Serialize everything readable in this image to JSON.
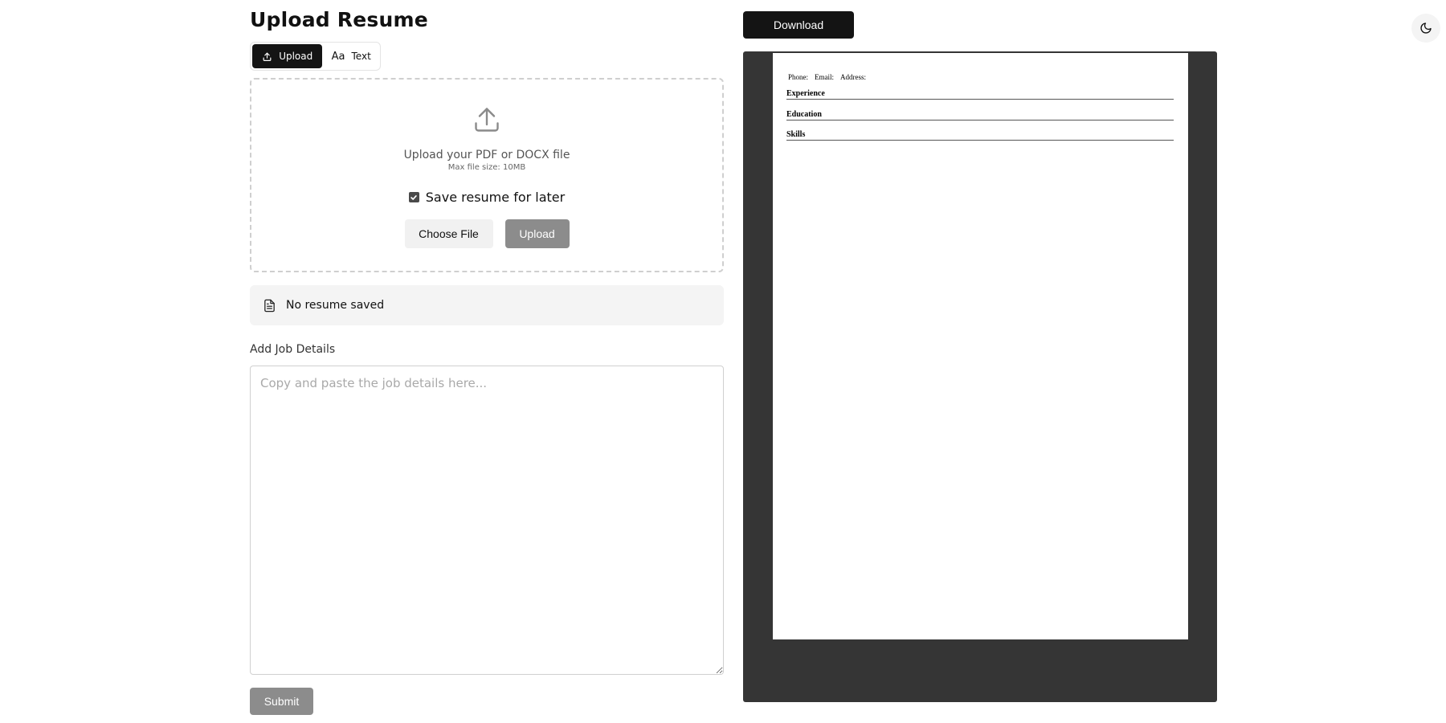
{
  "page": {
    "title": "Upload Resume"
  },
  "mode_tabs": [
    {
      "label": "Upload",
      "active": true,
      "icon": "upload-icon"
    },
    {
      "label": "Text",
      "active": false,
      "icon": "aa-text-icon",
      "glyph": "Aa"
    }
  ],
  "dropzone": {
    "title": "Upload your PDF or DOCX file",
    "subtitle": "Max file size: 10MB",
    "save_label": "Save resume for later",
    "save_checked": true,
    "choose_file_label": "Choose File",
    "upload_label": "Upload"
  },
  "resume_status": {
    "text": "No resume saved",
    "icon": "document-icon"
  },
  "job": {
    "label": "Add Job Details",
    "placeholder": "Copy and paste the job details here...",
    "value": ""
  },
  "submit_label": "Submit",
  "download_label": "Download",
  "theme_toggle": {
    "icon": "moon-icon"
  },
  "preview": {
    "contact": [
      "Phone:",
      "Email:",
      "Address:"
    ],
    "sections": [
      "Experience",
      "Education",
      "Skills"
    ]
  },
  "colors": {
    "primary_dark": "#141414",
    "disabled_gray": "#8c8c8c",
    "preview_bg": "#353535",
    "muted_bg": "#f4f4f4"
  }
}
